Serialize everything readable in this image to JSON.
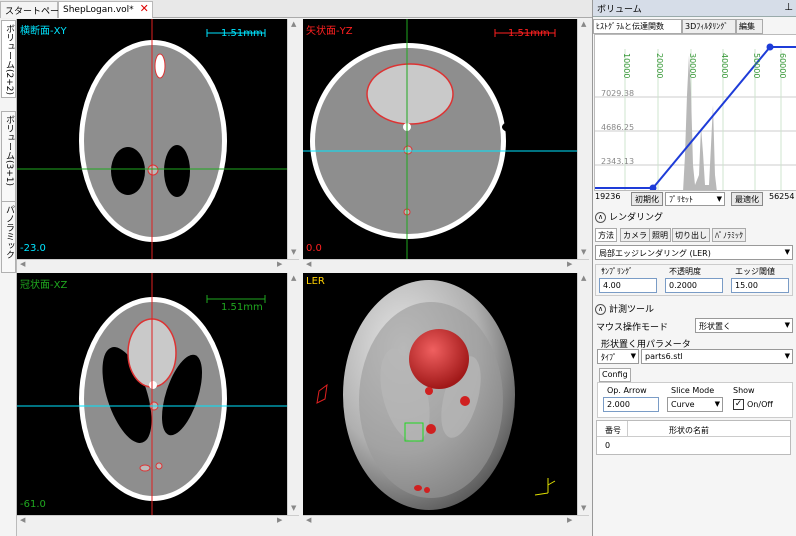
{
  "tabs": [
    {
      "label": "スタートページ"
    },
    {
      "label": "ShepLogan.vol*"
    }
  ],
  "sidebar": {
    "items": [
      {
        "label": "ボリューム(2+2)"
      },
      {
        "label": "ボリューム(3+1)"
      },
      {
        "label": "パノラミック"
      }
    ]
  },
  "views": {
    "axial": {
      "title": "横断面-XY",
      "scale": "1.51mm",
      "slice": "-23.0",
      "color": "#00e5ff"
    },
    "sagittal": {
      "title": "矢状面-YZ",
      "scale": "1.51mm",
      "slice": "0.0",
      "color": "#ff2020"
    },
    "coronal": {
      "title": "冠状面-XZ",
      "scale": "1.51mm",
      "slice": "-61.0",
      "color": "#1fa81f"
    },
    "render": {
      "title": "LER",
      "color": "#ffd000"
    }
  },
  "panel": {
    "title": "ボリューム",
    "pin": "📌",
    "tabs": [
      {
        "label": "ﾋｽﾄｸﾞﾗﾑと伝達関数"
      },
      {
        "label": "3Dﾌｨﾙﾀﾘﾝｸﾞ"
      },
      {
        "label": "編集"
      }
    ],
    "histogram": {
      "x_ticks": [
        "10000",
        "20000",
        "30000",
        "40000",
        "50000",
        "60000"
      ],
      "y_ticks": [
        "7029.38",
        "4686.25",
        "2343.13"
      ],
      "min": "19236",
      "max": "56254",
      "init_button": "初期化",
      "preset": "ﾌﾟﾘｾｯﾄ",
      "optimize_button": "最適化"
    },
    "rendering": {
      "header": "レンダリング",
      "tabs": [
        {
          "label": "方法"
        },
        {
          "label": "カメラ"
        },
        {
          "label": "照明"
        },
        {
          "label": "切り出し"
        },
        {
          "label": "ﾊﾟﾉﾗﾐｯｸ"
        }
      ],
      "method": "局部エッジレンダリング (LER)",
      "sampling_label": "ｻﾝﾌﾟﾘﾝｸﾞ",
      "sampling_value": "4.00",
      "opacity_label": "不透明度",
      "opacity_value": "0.2000",
      "edge_label": "エッジ閾値",
      "edge_value": "15.00"
    },
    "measure": {
      "header": "計測ツール",
      "mouse_mode_label": "マウス操作モード",
      "mouse_mode_value": "形状置く",
      "param_label": "形状置く用パラメータ",
      "type_label": "ﾀｲﾌﾟ",
      "type_value": "parts6.stl",
      "config_tab": "Config",
      "op_arrow_label": "Op. Arrow",
      "op_arrow_value": "2.000",
      "slice_mode_label": "Slice Mode",
      "slice_mode_value": "Curve",
      "show_label": "Show",
      "show_value": "On/Off",
      "grid_col1": "番号",
      "grid_col2": "形状の名前",
      "grid_row1": "0"
    }
  }
}
